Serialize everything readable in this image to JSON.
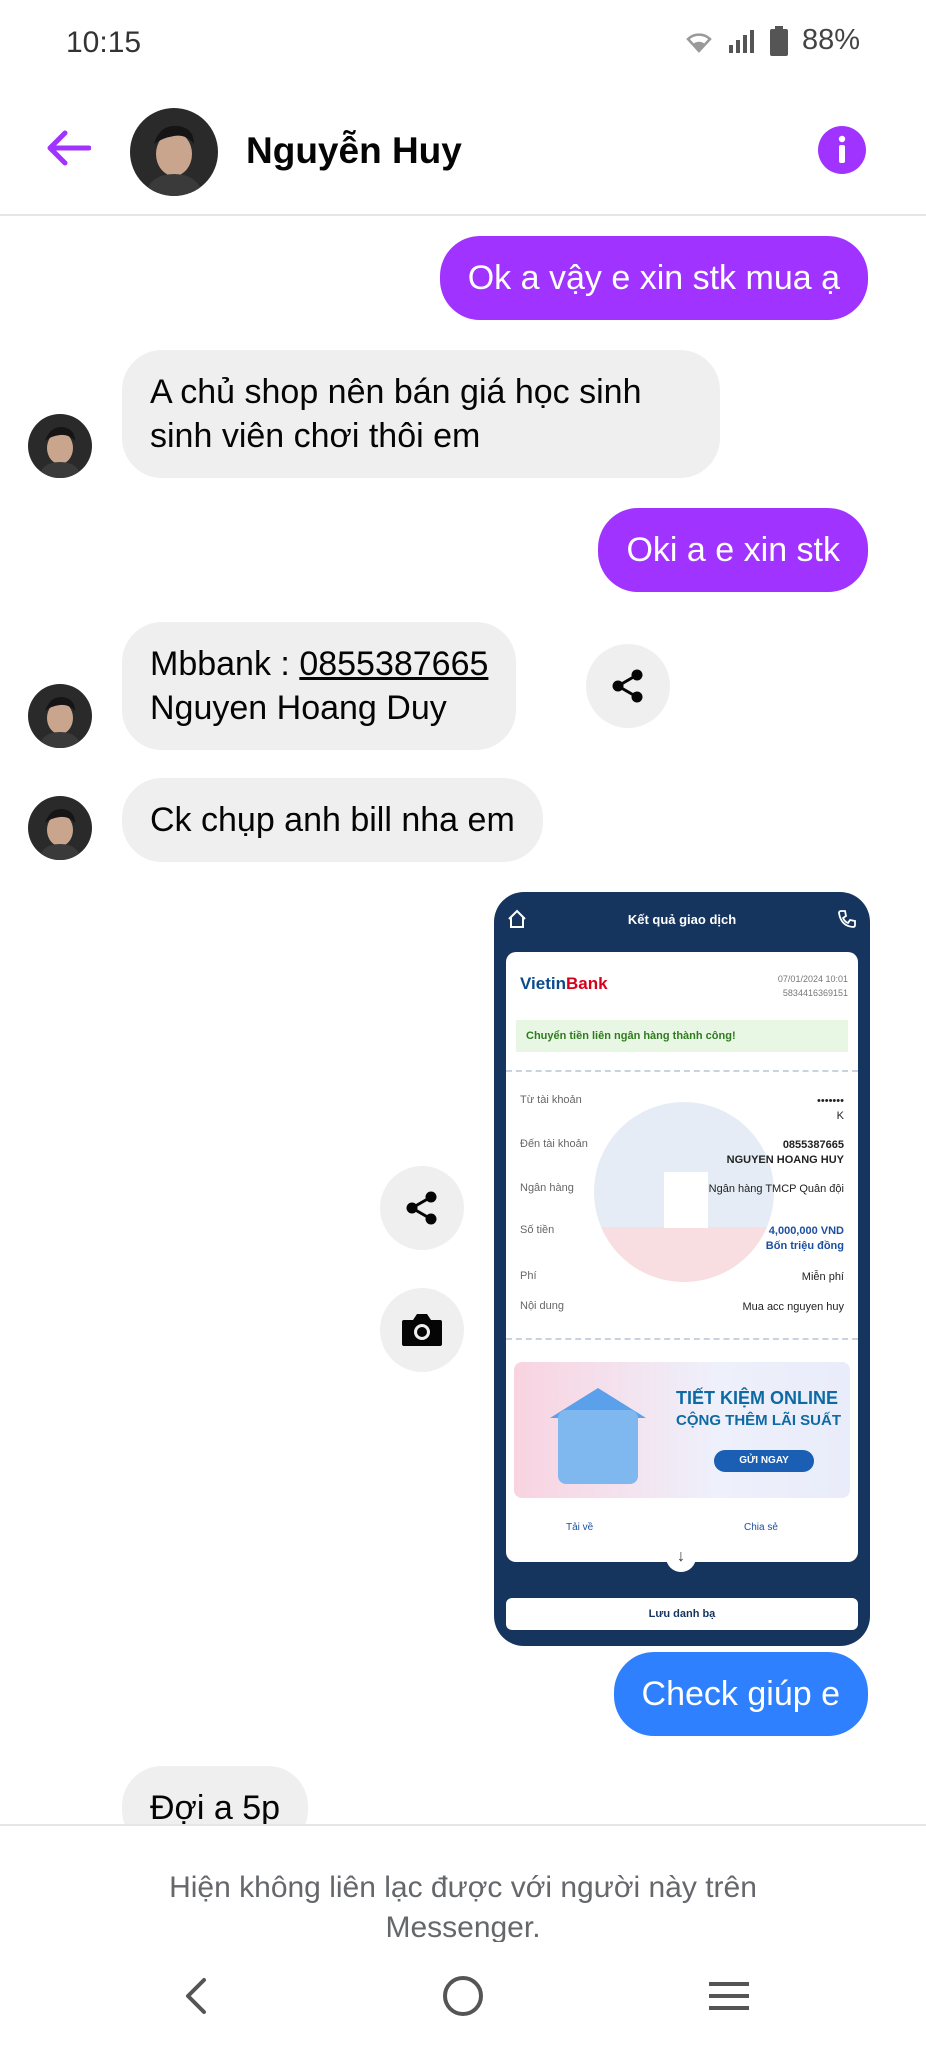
{
  "status_bar": {
    "time": "10:15",
    "battery": "88%"
  },
  "header": {
    "contact_name": "Nguyễn Huy"
  },
  "messages": [
    {
      "text": "Ok a vậy e xin stk mua ạ"
    },
    {
      "text": "A chủ shop nên bán giá học sinh\nsinh viên chơi thôi em"
    },
    {
      "text": "Oki a e xin stk"
    },
    {
      "line1_prefix": "Mbbank : ",
      "line1_number": "0855387665",
      "line2": "Nguyen Hoang Duy"
    },
    {
      "text": "Ck chụp anh bill nha em"
    },
    {
      "text": "Check giúp e"
    },
    {
      "text": "Đợi a 5p"
    }
  ],
  "receipt": {
    "title": "Kết quả giao dịch",
    "bank_logo": "VietinBank",
    "datetime": "07/01/2024 10:01",
    "transaction_id": "5834416369151",
    "success_text": "Chuyển tiền liên ngân hàng thành công!",
    "rows": [
      {
        "label": "Từ tài khoản",
        "value": "•••••••\nK"
      },
      {
        "label": "Đến tài khoản",
        "value": "0855387665\nNGUYEN HOANG HUY"
      },
      {
        "label": "Ngân hàng",
        "value": "Ngân hàng TMCP Quân đội"
      },
      {
        "label": "Số tiền",
        "value": "4,000,000 VND\nBốn triệu đồng"
      },
      {
        "label": "Phí",
        "value": "Miễn phí"
      },
      {
        "label": "Nội dung",
        "value": "Mua acc nguyen huy"
      }
    ],
    "banner_line1": "TIẾT KIỆM ONLINE",
    "banner_line2": "CỘNG THÊM LÃI SUẤT",
    "banner_button": "GỬI NGAY",
    "action_download": "Tải về",
    "action_share": "Chia sẻ",
    "save_contact": "Lưu danh bạ"
  },
  "footer": {
    "blocked_text": "Hiện không liên lạc được với người này trên Messenger."
  },
  "colors": {
    "accent_purple": "#a033ff",
    "outgoing_blue": "#2f80ff",
    "incoming_gray": "#efefef"
  },
  "icons": [
    "wifi-icon",
    "signal-icon",
    "battery-icon",
    "back-arrow-icon",
    "info-icon",
    "share-icon",
    "camera-icon",
    "nav-back-icon",
    "nav-home-icon",
    "nav-recents-icon"
  ]
}
